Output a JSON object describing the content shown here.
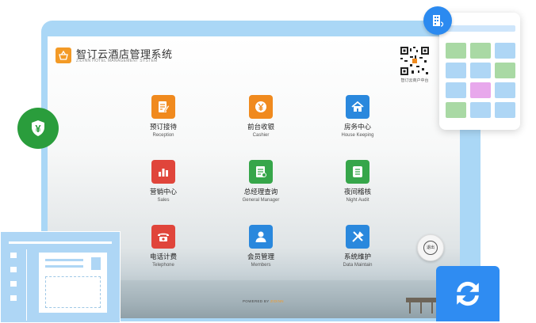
{
  "app": {
    "title": "智订云酒店管理系统",
    "subtitle": "ZIDINN HOTEL MANAGEMENT SYSTEM",
    "qr_caption": "智订云商户中台",
    "exit_label": "退出",
    "powered_prefix": "POWERED BY",
    "powered_brand": "ZIDINN"
  },
  "tiles": [
    {
      "zh": "预订接待",
      "en": "Reception",
      "icon": "pencil-note-icon",
      "color": "#f08a1e"
    },
    {
      "zh": "前台收银",
      "en": "Cashier",
      "icon": "yen-coin-icon",
      "color": "#f08a1e"
    },
    {
      "zh": "房务中心",
      "en": "House Keeping",
      "icon": "house-icon",
      "color": "#2a88dd"
    },
    {
      "zh": "营销中心",
      "en": "Sales",
      "icon": "bar-chart-icon",
      "color": "#e0453b"
    },
    {
      "zh": "总经理查询",
      "en": "General Manager",
      "icon": "report-icon",
      "color": "#36a64a"
    },
    {
      "zh": "夜间稽核",
      "en": "Night Audit",
      "icon": "audit-list-icon",
      "color": "#36a64a"
    },
    {
      "zh": "电话计费",
      "en": "Telephone",
      "icon": "telephone-icon",
      "color": "#e0453b"
    },
    {
      "zh": "会员管理",
      "en": "Members",
      "icon": "member-user-icon",
      "color": "#2a88dd"
    },
    {
      "zh": "系统维护",
      "en": "Data Maintain",
      "icon": "tools-icon",
      "color": "#2a88dd"
    }
  ],
  "decor": {
    "shield_symbol": "¥",
    "grid_colors": [
      "#a9d9a4",
      "#a9d9a4",
      "#aed6f5",
      "#aed6f5",
      "#aed6f5",
      "#a9d9a4",
      "#aed6f5",
      "#e8a8ec",
      "#aed6f5",
      "#a9d9a4",
      "#aed6f5",
      "#aed6f5"
    ]
  }
}
